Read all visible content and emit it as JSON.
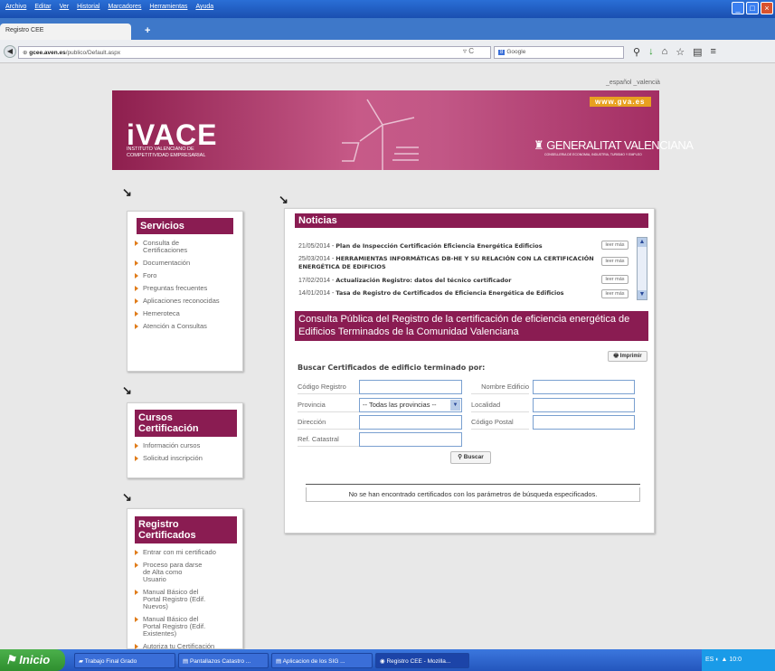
{
  "menu": [
    "Archivo",
    "Editar",
    "Ver",
    "Historial",
    "Marcadores",
    "Herramientas",
    "Ayuda"
  ],
  "tab": {
    "title": "Registro CEE",
    "new_tab": "+"
  },
  "url": {
    "host": "gcee.aven.es",
    "path": "/publico/Default.aspx"
  },
  "search": {
    "engine": "8",
    "placeholder": "Google"
  },
  "langs": "_español _valencià",
  "banner": {
    "gva": "www.gva.es",
    "ivace": "iVACE",
    "ivace_sub": "INSTITUTO VALENCIANO DE COMPETITIVIDAD EMPRESARIAL",
    "gv": "GENERALITAT VALENCIANA",
    "gv_sub": "CONSELLERIA DE ECONOMIA, INDUSTRIA, TURISMO Y EMPLEO"
  },
  "arrow": "↘",
  "servicios": {
    "title": "Servicios",
    "items": [
      "Consulta de Certificaciones",
      "Documentación",
      "Foro",
      "Preguntas frecuentes",
      "Aplicaciones reconocidas",
      "Hemeroteca",
      "Atención a Consultas"
    ]
  },
  "cursos": {
    "title": "Cursos Certificación",
    "items": [
      "Información cursos",
      "Solicitud inscripción"
    ]
  },
  "registro": {
    "title": "Registro Certificados",
    "items": [
      "Entrar con mi certificado",
      "Proceso para darse de Alta como Usuario",
      "Manual Básico del Portal Registro (Edif. Nuevos)",
      "Manual Básico del Portal Registro (Edif. Existentes)",
      "Autoriza tu Certificación"
    ]
  },
  "noticias": {
    "title": "Noticias",
    "leer": "leer más",
    "items": [
      {
        "date": "21/05/2014",
        "title": "Plan de Inspección Certificación Eficiencia Energética Edificios"
      },
      {
        "date": "25/03/2014",
        "title": "HERRAMIENTAS INFORMÁTICAS DB-HE Y SU RELACIÓN CON LA CERTIFICACIÓN ENERGÉTICA DE EDIFICIOS"
      },
      {
        "date": "17/02/2014",
        "title": "Actualización Registro: datos del técnico certificador"
      },
      {
        "date": "14/01/2014",
        "title": "Tasa de Registro de Certificados de Eficiencia Energética de Edificios"
      }
    ]
  },
  "consulta": {
    "title": "Consulta Pública del Registro de la certificación de eficiencia energética de Edificios Terminados de la Comunidad Valenciana",
    "imprimir": "Imprimir",
    "buscar_por": "Buscar Certificados de edificio terminado por:",
    "labels": {
      "codigo": "Código Registro",
      "nombre": "Nombre Edificio",
      "provincia": "Provincia",
      "localidad": "Localidad",
      "direccion": "Dirección",
      "cp": "Código Postal",
      "catastral": "Ref. Catastral"
    },
    "provincia_value": "-- Todas las provincias --",
    "buscar": "Buscar",
    "result": "No se han encontrado certificados con los parámetros de búsqueda especificados."
  },
  "taskbar": {
    "start": "Inicio",
    "tasks": [
      "Trabajo Final Grado",
      "Pantallazos Catastro ...",
      "Aplicacion de los SIG ...",
      "Registro CEE - Mozilla..."
    ],
    "tray_lang": "ES",
    "clock": "10:0"
  }
}
